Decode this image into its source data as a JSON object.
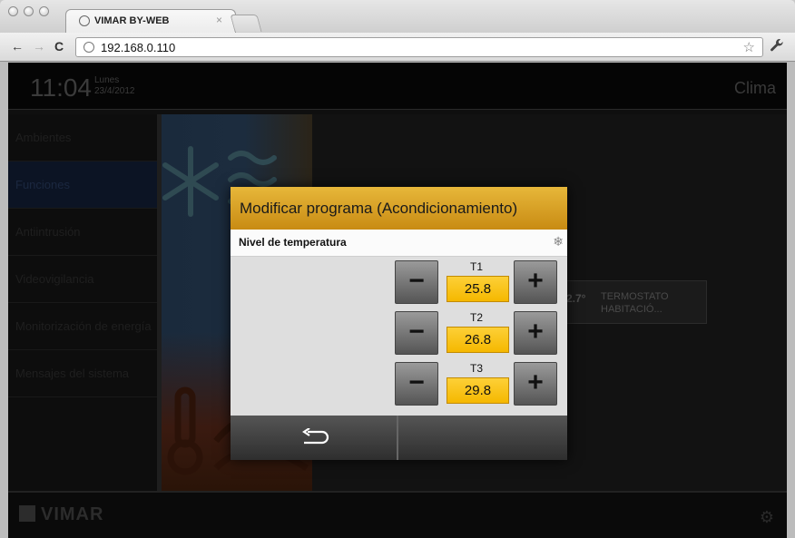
{
  "browser": {
    "tab_title": "VIMAR BY-WEB",
    "tab_close": "×",
    "back": "←",
    "forward": "→",
    "reload": "C",
    "url": "192.168.0.110",
    "bookmark_icon": "star-icon",
    "bookmark_glyph": "☆",
    "menu_icon": "wrench-icon",
    "menu_glyph": "🔧"
  },
  "header": {
    "time": "11:04",
    "day": "Lunes",
    "date": "23/4/2012",
    "title": "Clima"
  },
  "sidebar": {
    "items": [
      {
        "label": "Ambientes",
        "active": false
      },
      {
        "label": "Funciones",
        "active": true
      },
      {
        "label": "Antiintrusión",
        "active": false
      },
      {
        "label": "Videovigilancia",
        "active": false
      },
      {
        "label": "Monitorización de energía",
        "active": false
      },
      {
        "label": "Mensajes del sistema",
        "active": false
      }
    ]
  },
  "thermostat": {
    "temp": "2.7°",
    "name_line1": "TERMOSTATO",
    "name_line2": "HABITACIÓ..."
  },
  "footer": {
    "brand": "VIMAR"
  },
  "modal": {
    "title": "Modificar programa (Acondicionamiento)",
    "subtitle": "Nivel de temperatura",
    "mode_icon": "snowflake-icon",
    "minus_label": "−",
    "plus_label": "+",
    "levels": [
      {
        "label": "T1",
        "value": "25.8"
      },
      {
        "label": "T2",
        "value": "26.8"
      },
      {
        "label": "T3",
        "value": "29.8"
      }
    ],
    "back_icon": "return-arrow-icon"
  },
  "colors": {
    "modal_header": "#d9a126",
    "value_box": "#fcc419",
    "active_menu": "#0c1424"
  }
}
